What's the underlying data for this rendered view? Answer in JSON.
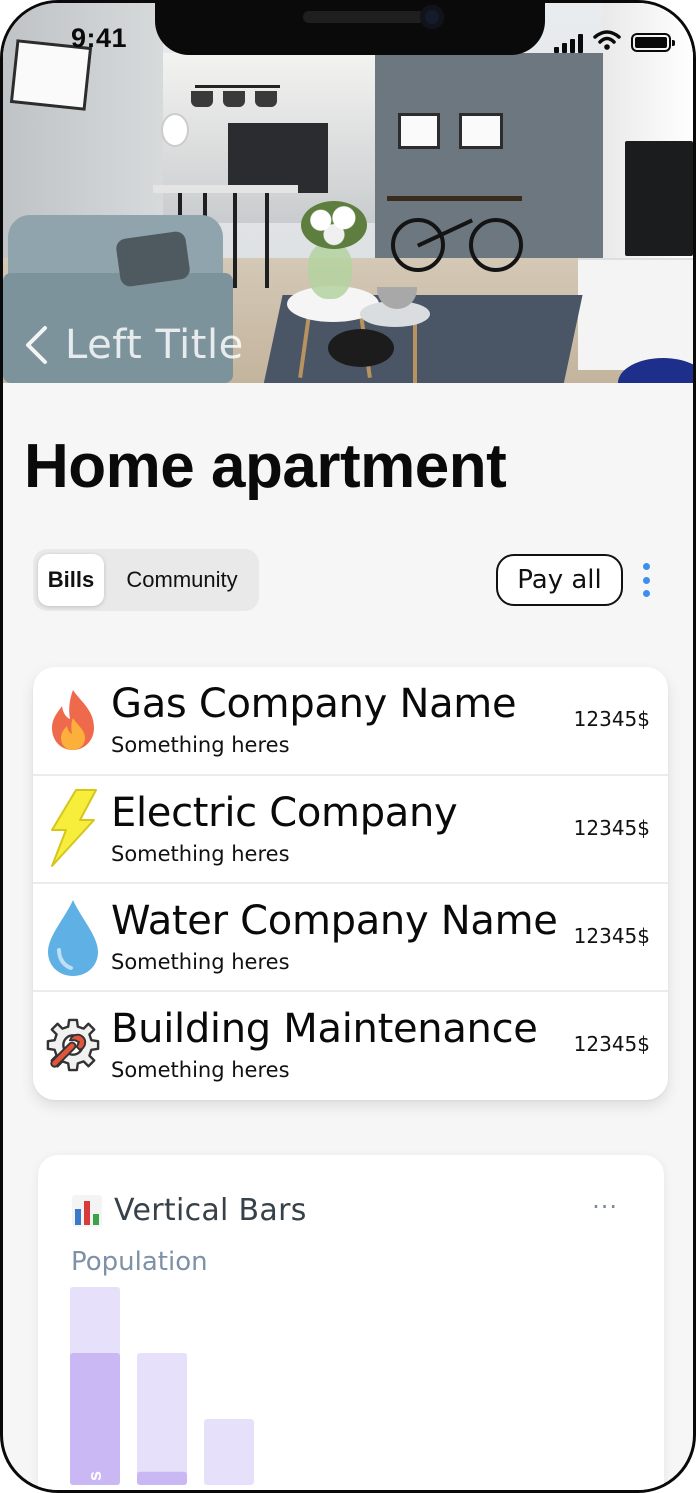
{
  "status_bar": {
    "time": "9:41"
  },
  "nav": {
    "back_title": "Left Title"
  },
  "page": {
    "title": "Home apartment"
  },
  "segmented": {
    "tabs": [
      {
        "label": "Bills",
        "active": true
      },
      {
        "label": "Community",
        "active": false
      }
    ]
  },
  "actions": {
    "pay_all_label": "Pay all"
  },
  "bills": [
    {
      "icon": "fire-icon",
      "name": "Gas Company Name",
      "subtitle": "Something heres",
      "amount": "12345$"
    },
    {
      "icon": "lightning-icon",
      "name": "Electric Company",
      "subtitle": "Something heres",
      "amount": "12345$"
    },
    {
      "icon": "water-drop-icon",
      "name": "Water Company Name",
      "subtitle": "Something heres",
      "amount": "12345$"
    },
    {
      "icon": "gear-wrench-icon",
      "name": "Building Maintenance",
      "subtitle": "Something heres",
      "amount": "12345$"
    }
  ],
  "chart_card": {
    "title": "Vertical Bars",
    "subtitle": "Population",
    "more_label": "···",
    "emoji_icon": "bar-chart-icon"
  },
  "chart_data": {
    "type": "bar",
    "title": "Vertical Bars",
    "subtitle": "Population",
    "categories": [
      "",
      "",
      ""
    ],
    "series": [
      {
        "values": [
          3,
          2,
          1
        ]
      },
      {
        "values": [
          2,
          0.2,
          0
        ]
      }
    ],
    "ylim": [
      0,
      3
    ],
    "bar_label": "s",
    "colors": {
      "background": "#e6e0fb",
      "foreground": "#c9b8f3",
      "label": "#ffffff"
    }
  },
  "colors": {
    "accent": "#3b8ff0",
    "card": "#ffffff",
    "page": "#f6f6f6"
  }
}
